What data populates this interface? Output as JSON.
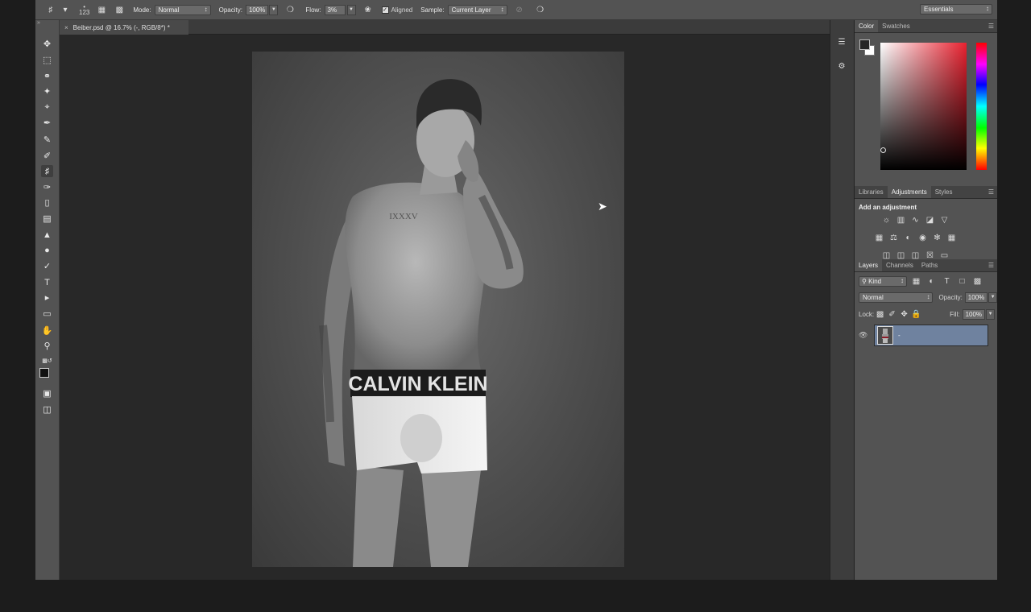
{
  "options_bar": {
    "brush_size": "123",
    "mode_label": "Mode:",
    "mode_value": "Normal",
    "opacity_label": "Opacity:",
    "opacity_value": "100%",
    "flow_label": "Flow:",
    "flow_value": "3%",
    "aligned_label": "Aligned",
    "sample_label": "Sample:",
    "sample_value": "Current Layer",
    "workspace": "Essentials"
  },
  "document": {
    "tab_title": "Beiber.psd @ 16.7% (-, RGB/8*) *",
    "close_glyph": "×"
  },
  "color_panel": {
    "tabs": [
      "Color",
      "Swatches"
    ],
    "foreground": "#262626",
    "background": "#ffffff"
  },
  "adjustments_panel": {
    "tabs": [
      "Libraries",
      "Adjustments",
      "Styles"
    ],
    "heading": "Add an adjustment"
  },
  "layers_panel": {
    "tabs": [
      "Layers",
      "Channels",
      "Paths"
    ],
    "filter_kind": "Kind",
    "blend_mode": "Normal",
    "opacity_label": "Opacity:",
    "opacity_value": "100%",
    "lock_label": "Lock:",
    "fill_label": "Fill:",
    "fill_value": "100%",
    "layer_name": "-"
  },
  "canvas_image": {
    "waistband_text": "CALVIN KLEIN",
    "tattoo_text": "IXXXV"
  }
}
